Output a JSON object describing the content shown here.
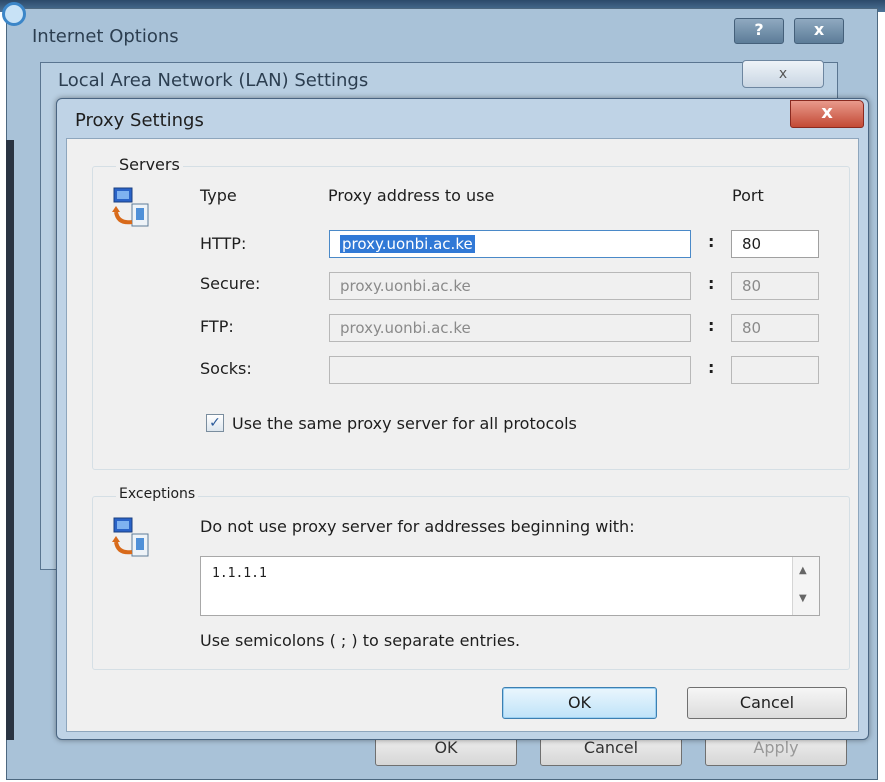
{
  "background": {
    "internet_options": {
      "title": "Internet Options",
      "help_label": "?",
      "close_label": "x",
      "footer": {
        "ok": "OK",
        "cancel": "Cancel",
        "apply": "Apply"
      }
    },
    "lan_settings": {
      "title": "Local Area Network (LAN) Settings",
      "close_label": "x"
    }
  },
  "dialog": {
    "title": "Proxy Settings",
    "close_label": "x",
    "servers": {
      "group_label": "Servers",
      "headers": {
        "type": "Type",
        "address": "Proxy address to use",
        "port": "Port"
      },
      "rows": [
        {
          "type": "HTTP:",
          "address": "proxy.uonbi.ac.ke",
          "port": "80",
          "enabled": true
        },
        {
          "type": "Secure:",
          "address": "proxy.uonbi.ac.ke",
          "port": "80",
          "enabled": false
        },
        {
          "type": "FTP:",
          "address": "proxy.uonbi.ac.ke",
          "port": "80",
          "enabled": false
        },
        {
          "type": "Socks:",
          "address": "",
          "port": "",
          "enabled": false
        }
      ],
      "colon": ":",
      "same_proxy": {
        "checked": true,
        "label": "Use the same proxy server for all protocols"
      }
    },
    "exceptions": {
      "group_label": "Exceptions",
      "instruction": "Do not use proxy server for addresses beginning with:",
      "value": "1.1.1.1",
      "hint": "Use semicolons ( ; ) to separate entries."
    },
    "buttons": {
      "ok": "OK",
      "cancel": "Cancel"
    }
  },
  "icons": {
    "network": "network-computer-icon",
    "checkbox": "checkmark-icon",
    "scroll_up": "scroll-up-arrow-icon",
    "scroll_down": "scroll-down-arrow-icon"
  },
  "colors": {
    "title_bar": "#bfd3e6",
    "close_button": "#c34a35",
    "selection": "#3179d6",
    "ok_button": "#bfe3f9"
  }
}
